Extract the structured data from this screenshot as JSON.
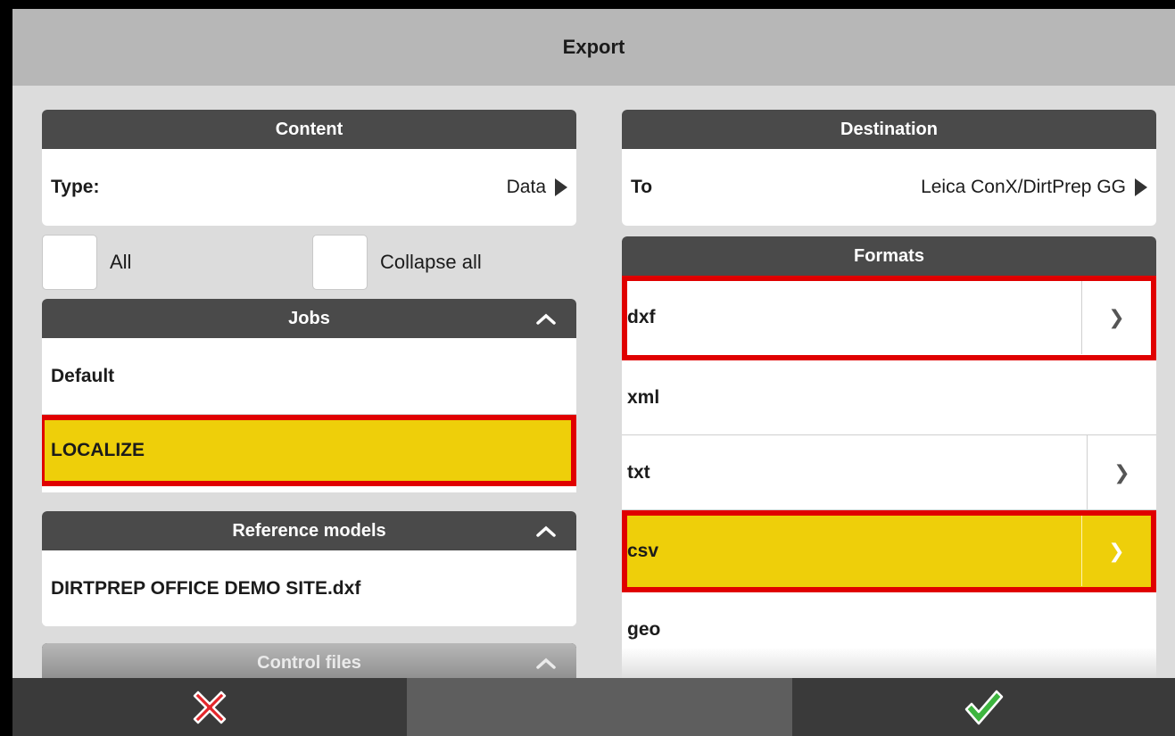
{
  "window": {
    "title": "Export"
  },
  "content_panel": {
    "header": "Content",
    "type_label": "Type:",
    "type_value": "Data"
  },
  "checkboxes": {
    "all_label": "All",
    "collapse_label": "Collapse all"
  },
  "jobs": {
    "header": "Jobs",
    "items": [
      {
        "label": "Default",
        "selected": false
      },
      {
        "label": "LOCALIZE",
        "selected": true
      }
    ]
  },
  "reference_models": {
    "header": "Reference models",
    "items": [
      {
        "label": "DIRTPREP OFFICE DEMO SITE.dxf"
      }
    ]
  },
  "control_files": {
    "header": "Control files"
  },
  "destination": {
    "header": "Destination",
    "to_label": "To",
    "to_value": "Leica ConX/DirtPrep GG"
  },
  "formats": {
    "header": "Formats",
    "items": [
      {
        "label": "dxf",
        "has_chevron": true,
        "selected": false
      },
      {
        "label": "xml",
        "has_chevron": false,
        "selected": false
      },
      {
        "label": "txt",
        "has_chevron": true,
        "selected": false
      },
      {
        "label": "csv",
        "has_chevron": true,
        "selected": true
      },
      {
        "label": "geo",
        "has_chevron": false,
        "selected": false
      }
    ],
    "chevron_glyph": "❯"
  },
  "bottom_bar": {
    "cancel_icon": "red-x-icon",
    "confirm_icon": "green-check-icon"
  },
  "colors": {
    "selected": "#eecf0a",
    "highlight": "#e00000",
    "header": "#4a4a4a"
  }
}
